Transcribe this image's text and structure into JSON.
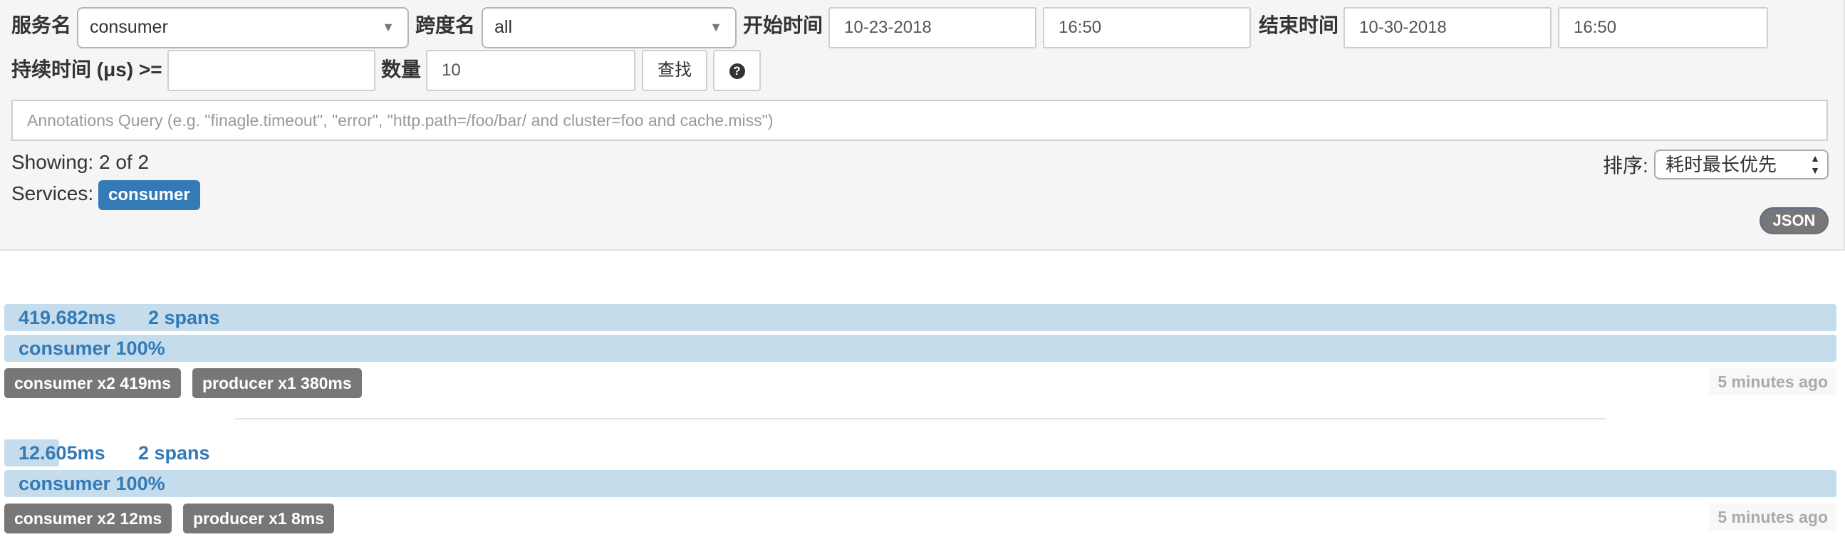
{
  "filters": {
    "service_label": "服务名",
    "service_value": "consumer",
    "span_label": "跨度名",
    "span_value": "all",
    "start_label": "开始时间",
    "start_date": "10-23-2018",
    "start_time": "16:50",
    "end_label": "结束时间",
    "end_date": "10-30-2018",
    "end_time": "16:50",
    "duration_label": "持续时间 (μs) >=",
    "duration_value": "",
    "limit_label": "数量",
    "limit_value": "10",
    "find_button": "查找",
    "help_icon": "question-circle-icon",
    "help_glyph": "?",
    "annotations_placeholder": "Annotations Query (e.g. \"finagle.timeout\", \"error\", \"http.path=/foo/bar/ and cluster=foo and cache.miss\")"
  },
  "results": {
    "showing": "Showing: 2 of 2",
    "services_label": "Services:",
    "services": [
      "consumer"
    ],
    "sort_label": "排序:",
    "sort_value": "耗时最长优先",
    "json_button": "JSON"
  },
  "traces": [
    {
      "duration": "419.682ms",
      "spans": "2 spans",
      "service_pct": "consumer 100%",
      "duration_fill_fraction": 1.0,
      "tags": [
        "consumer x2 419ms",
        "producer x1 380ms"
      ],
      "time_ago": "5 minutes ago"
    },
    {
      "duration": "12.605ms",
      "spans": "2 spans",
      "service_pct": "consumer 100%",
      "duration_fill_fraction": 0.03,
      "tags": [
        "consumer x2 12ms",
        "producer x1 8ms"
      ],
      "time_ago": "5 minutes ago"
    }
  ],
  "colors": {
    "accent": "#337ab7",
    "bar": "#c4dceb",
    "tag": "#777777",
    "panel": "#f5f5f5"
  }
}
